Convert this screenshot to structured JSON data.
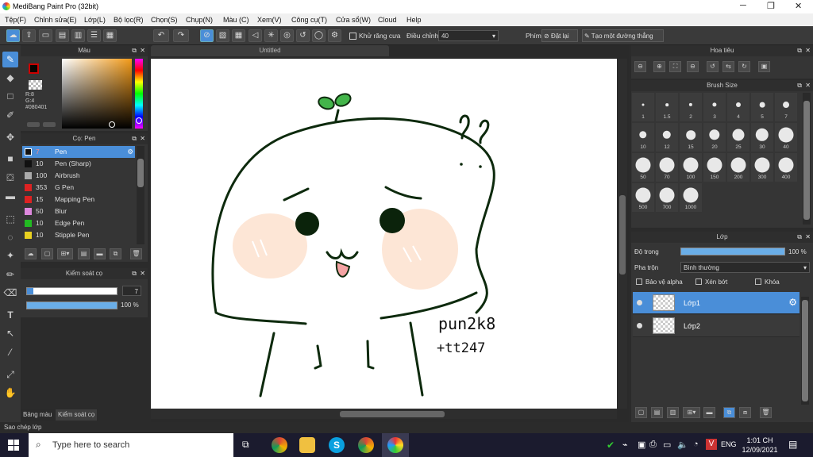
{
  "window": {
    "title": "MediBang Paint Pro (32bit)",
    "controls": [
      "─",
      "❐",
      "✕"
    ]
  },
  "menu": [
    "Tệp(F)",
    "Chỉnh sửa(E)",
    "Lớp(L)",
    "Bộ lọc(R)",
    "Chọn(S)",
    "Chụp(N)",
    "Màu (C)",
    "Xem(V)",
    "Công cụ(T)",
    "Cửa sổ(W)",
    "Cloud",
    "Help"
  ],
  "toolbar": {
    "antialias": "Khử răng cưa",
    "adjust_label": "Điều chỉnh",
    "adjust_value": "40",
    "key_label": "Phím",
    "reset": "Đặt lại",
    "line": "Tạo một đường thẳng"
  },
  "color_panel": {
    "title": "Màu",
    "r": "R:8",
    "g": "G:4",
    "hex": "#080401",
    "fg": "#080401",
    "bg": "#ffffff"
  },
  "brush_panel": {
    "title": "Cọ: Pen",
    "items": [
      {
        "n": "7",
        "name": "Pen",
        "color": "#111111",
        "selected": true
      },
      {
        "n": "10",
        "name": "Pen (Sharp)",
        "color": "#111111"
      },
      {
        "n": "100",
        "name": "Airbrush",
        "color": "#aaaaaa"
      },
      {
        "n": "353",
        "name": "G Pen",
        "color": "#dd2222"
      },
      {
        "n": "15",
        "name": "Mapping Pen",
        "color": "#dd2222"
      },
      {
        "n": "50",
        "name": "Blur",
        "color": "#dd88dd"
      },
      {
        "n": "10",
        "name": "Edge Pen",
        "color": "#22bb22"
      },
      {
        "n": "10",
        "name": "Stipple Pen",
        "color": "#e8d020"
      }
    ]
  },
  "brush_control": {
    "title": "Kiểm soát cọ",
    "size": "7",
    "opacity": "100",
    "opacity_unit": "%",
    "size_fraction": 0.07,
    "opacity_fraction": 1.0
  },
  "left_tabs": [
    "Bảng màu",
    "Kiểm soát cọ"
  ],
  "canvas": {
    "tab": "Untitled",
    "signature_line1": "pun2k8",
    "signature_line2": "+tt247",
    "marks": "??"
  },
  "navigator": {
    "title": "Hoa tiêu"
  },
  "brush_size": {
    "title": "Brush Size",
    "sizes": [
      "1",
      "1.5",
      "2",
      "3",
      "4",
      "5",
      "7",
      "10",
      "12",
      "15",
      "20",
      "25",
      "30",
      "40",
      "50",
      "70",
      "100",
      "150",
      "200",
      "300",
      "400",
      "500",
      "700",
      "1000"
    ]
  },
  "layer_panel": {
    "title": "Lớp",
    "opacity_label": "Độ trong",
    "opacity_value": "100",
    "opacity_unit": "%",
    "blend_label": "Pha trộn",
    "blend_value": "Bình thường",
    "alpha_lock": "Bảo vệ alpha",
    "clip": "Xén bớt",
    "lock": "Khóa",
    "layers": [
      {
        "name": "Lớp1",
        "selected": true
      },
      {
        "name": "Lớp2",
        "selected": false
      }
    ]
  },
  "status": {
    "text": "Sao chép lớp"
  },
  "taskbar": {
    "search_placeholder": "Type here to search",
    "lang": "ENG",
    "time": "1:01 CH",
    "date": "12/09/2021"
  },
  "colors": {
    "accent": "#4a8ed8",
    "panel": "#353535",
    "selected_row": "#4a8ed8"
  }
}
